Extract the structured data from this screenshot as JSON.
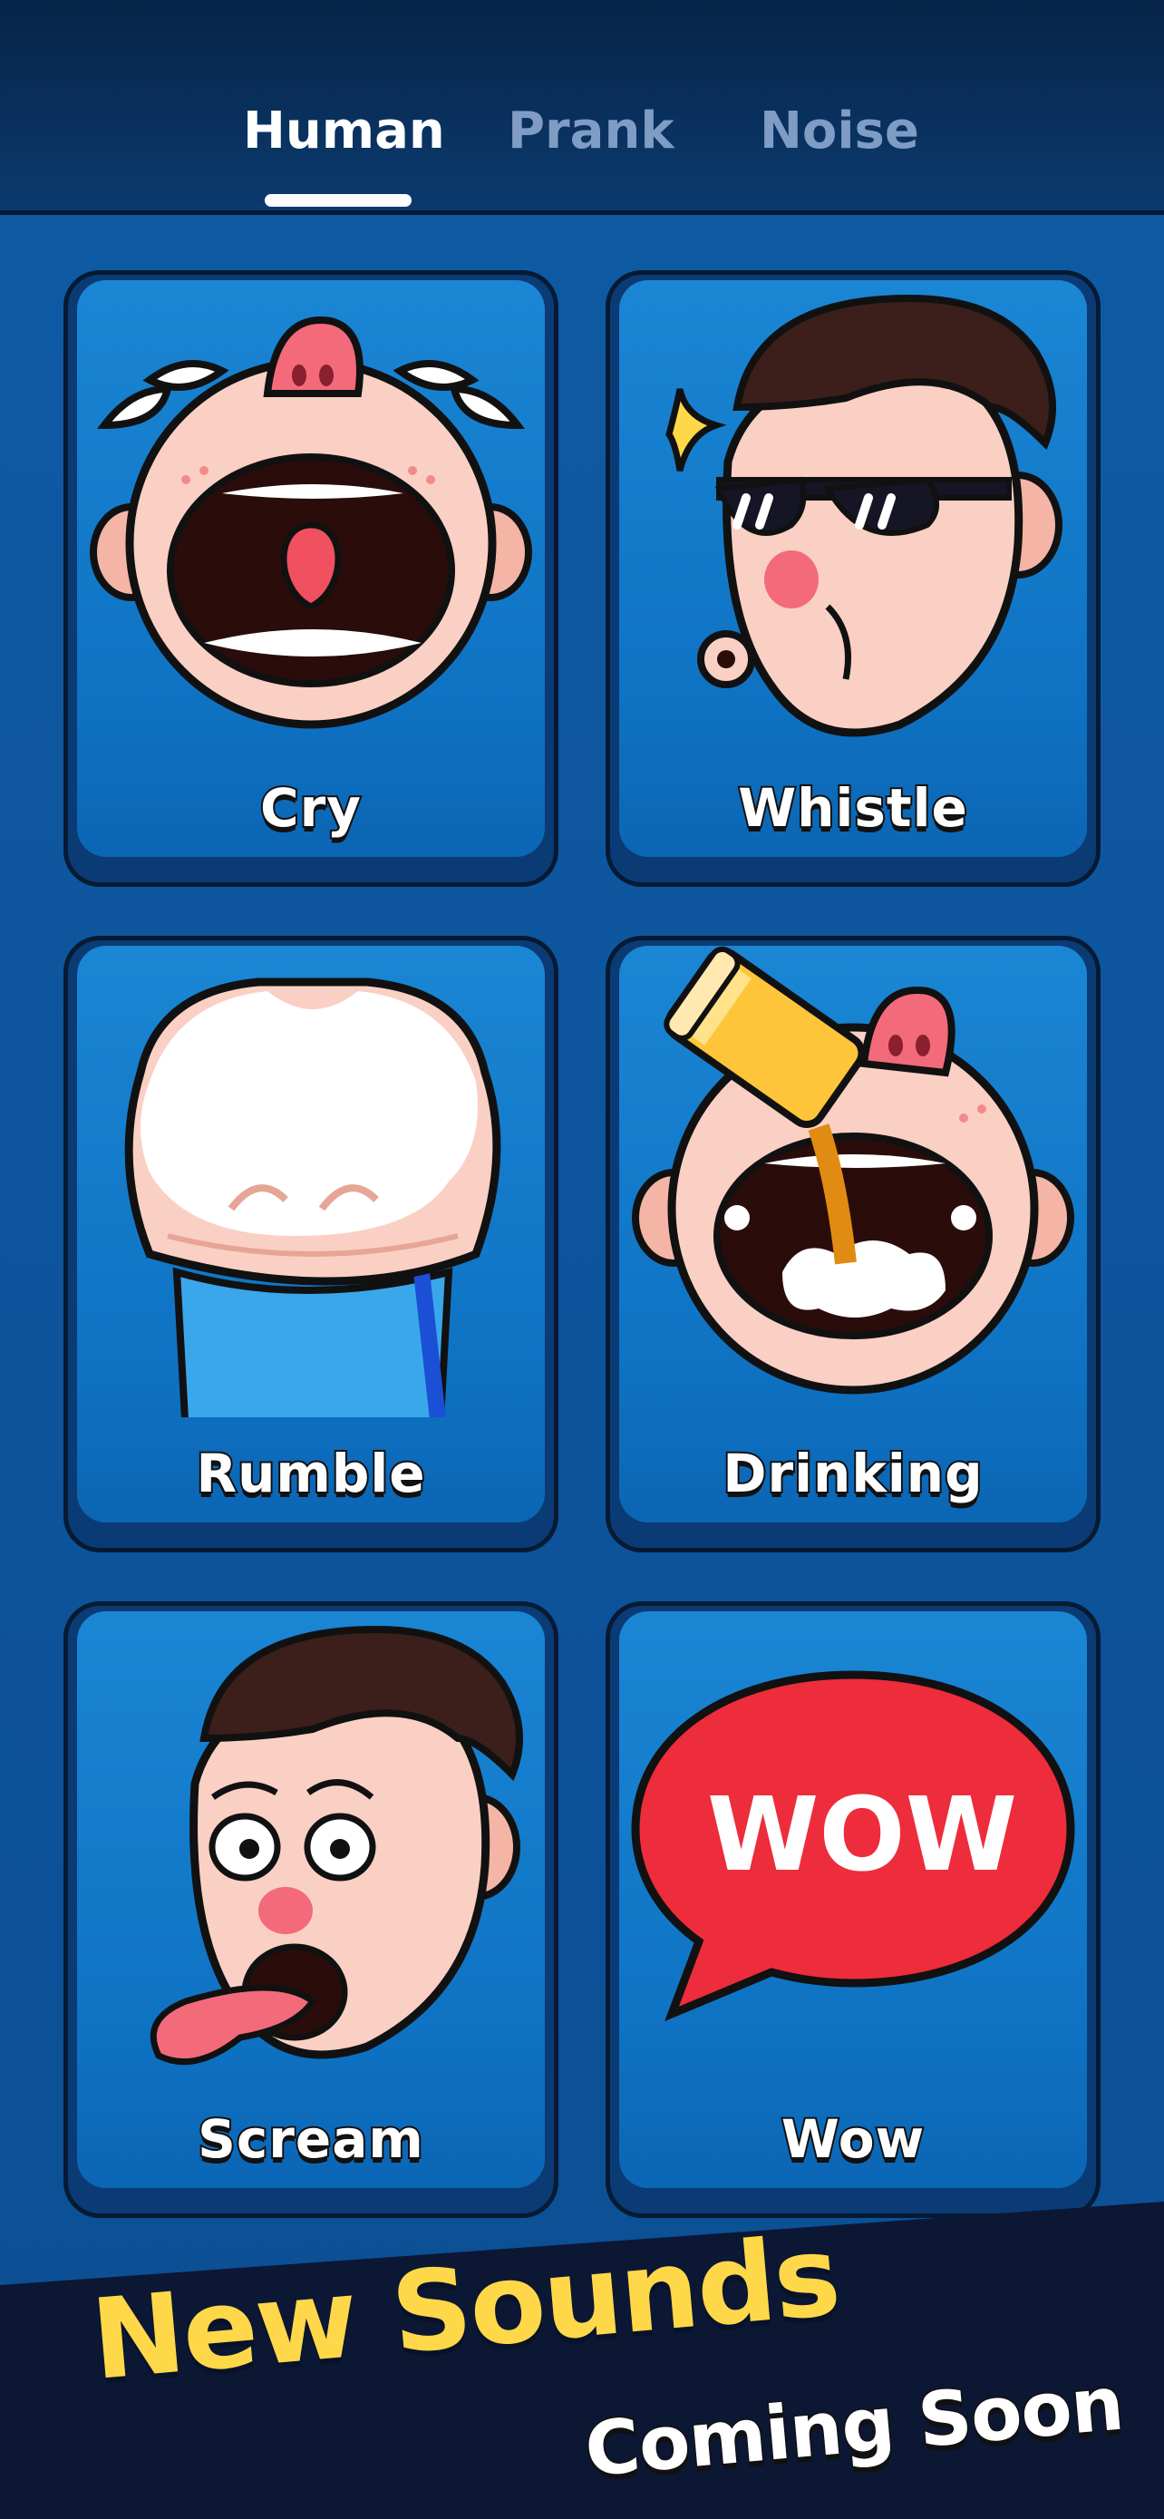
{
  "tabs": [
    {
      "label": "Human",
      "active": true
    },
    {
      "label": "Prank",
      "active": false
    },
    {
      "label": "Noise",
      "active": false
    }
  ],
  "cards": [
    {
      "label": "Cry",
      "icon": "crying-baby-icon"
    },
    {
      "label": "Whistle",
      "icon": "whistling-man-icon"
    },
    {
      "label": "Rumble",
      "icon": "belly-rumble-icon"
    },
    {
      "label": "Drinking",
      "icon": "drinking-baby-icon"
    },
    {
      "label": "Scream",
      "icon": "screaming-man-icon"
    },
    {
      "label": "Wow",
      "icon": "wow-speech-bubble-icon",
      "bubble_text": "WOW"
    }
  ],
  "promo": {
    "title": "New Sounds",
    "subtitle": "Coming Soon"
  },
  "colors": {
    "header_bg": "#072448",
    "grid_bg": "#0e5aa3",
    "card_face": "#1a86d4",
    "card_edge": "#0a3b75",
    "promo_band": "#0b1733",
    "promo_title": "#ffd84a",
    "tab_active": "#ffffff",
    "tab_inactive": "#7f9cc5"
  }
}
